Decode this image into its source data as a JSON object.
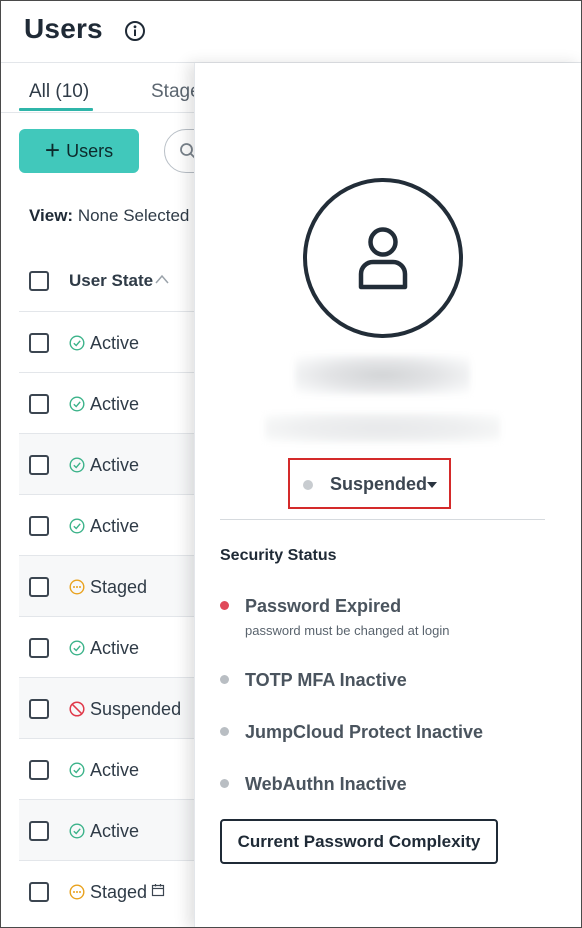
{
  "header": {
    "title": "Users",
    "info_icon": "info-icon"
  },
  "tabs": [
    {
      "label": "All (10)",
      "active": true
    },
    {
      "label": "Stage"
    }
  ],
  "toolbar": {
    "add_users_label": "Users",
    "add_icon": "plus-icon",
    "search_icon": "search-icon"
  },
  "view": {
    "label": "View:",
    "value": "None Selected"
  },
  "table": {
    "column_header": "User State",
    "rows": [
      {
        "state": "Active",
        "icon": "check-circle-icon"
      },
      {
        "state": "Active",
        "icon": "check-circle-icon"
      },
      {
        "state": "Active",
        "icon": "check-circle-icon"
      },
      {
        "state": "Active",
        "icon": "check-circle-icon"
      },
      {
        "state": "Staged",
        "icon": "ellipsis-circle-icon"
      },
      {
        "state": "Active",
        "icon": "check-circle-icon"
      },
      {
        "state": "Suspended",
        "icon": "prohibited-icon"
      },
      {
        "state": "Active",
        "icon": "check-circle-icon"
      },
      {
        "state": "Active",
        "icon": "check-circle-icon"
      },
      {
        "state": "Staged",
        "icon": "ellipsis-circle-icon",
        "extra_icon": "calendar-icon"
      }
    ]
  },
  "panel": {
    "avatar_icon": "user-icon",
    "status": {
      "label": "Suspended",
      "dot_color": "#c8ccd0"
    },
    "security_title": "Security Status",
    "security_items": [
      {
        "label": "Password Expired",
        "sub": "password must be changed at login",
        "dot_color": "#e04a5a"
      },
      {
        "label": "TOTP MFA Inactive",
        "dot_color": "#b9bec3"
      },
      {
        "label": "JumpCloud Protect Inactive",
        "dot_color": "#b9bec3"
      },
      {
        "label": "WebAuthn Inactive",
        "dot_color": "#b9bec3"
      }
    ],
    "complexity_button": "Current Password Complexity"
  },
  "colors": {
    "accent": "#41c8bb",
    "tab_underline": "#2fb5a9",
    "active": "#3cb38a",
    "staged": "#e9a21e",
    "suspended": "#e0394a",
    "highlight_border": "#d42a2a"
  }
}
